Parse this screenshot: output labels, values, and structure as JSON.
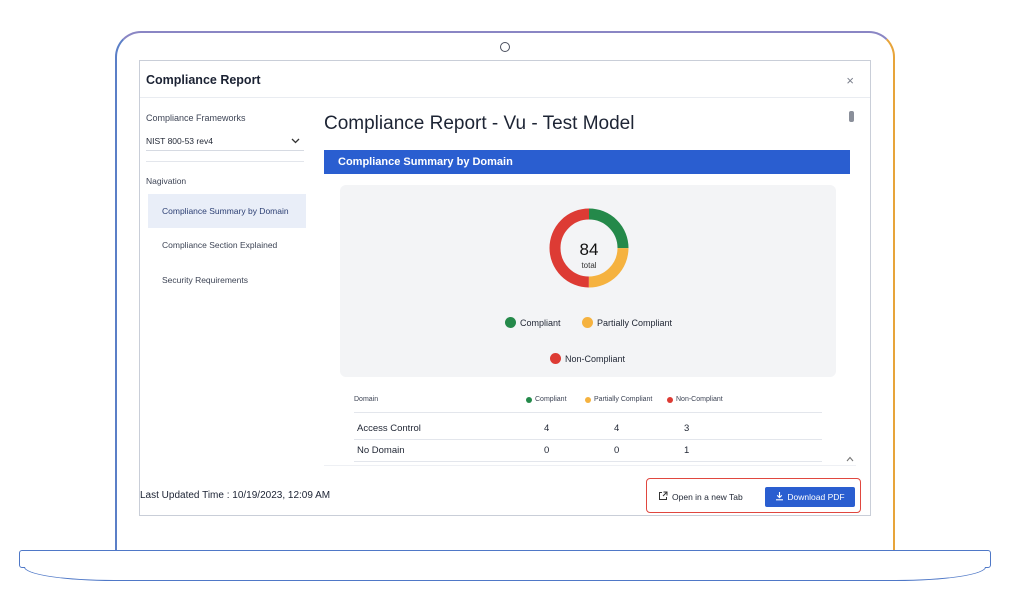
{
  "dialog": {
    "title": "Compliance Report",
    "close_glyph": "×"
  },
  "sidebar": {
    "frameworks_label": "Compliance Frameworks",
    "framework_selected": "NIST 800-53 rev4",
    "navigation_label": "Nagivation",
    "nav_items": [
      {
        "label": "Compliance Summary by Domain",
        "active": true
      },
      {
        "label": "Compliance Section Explained",
        "active": false
      },
      {
        "label": "Security Requirements",
        "active": false
      }
    ]
  },
  "report": {
    "title": "Compliance Report - Vu - Test Model",
    "section_header": "Compliance Summary by Domain"
  },
  "summary": {
    "total_value": "84",
    "total_label": "total",
    "segments": [
      {
        "name": "Compliant",
        "count": 21,
        "color": "#24894a"
      },
      {
        "name": "Partially Compliant",
        "count": 21,
        "color": "#f5b23f"
      },
      {
        "name": "Non-Compliant",
        "count": 42,
        "color": "#dd3b34"
      }
    ]
  },
  "table": {
    "headers": {
      "domain": "Domain",
      "compliant": "Compliant",
      "partial": "Partially Compliant",
      "noncompliant": "Non-Compliant"
    },
    "rows": [
      {
        "domain": "Access Control",
        "compliant": "4",
        "partial": "4",
        "noncompliant": "3"
      },
      {
        "domain": "No Domain",
        "compliant": "0",
        "partial": "0",
        "noncompliant": "1"
      }
    ]
  },
  "footer": {
    "last_updated": "Last Updated Time : 10/19/2023, 12:09 AM",
    "open_tab_label": "Open in a new Tab",
    "download_label": "Download PDF"
  },
  "icons": {
    "open": "external-link-icon",
    "download": "download-icon",
    "dropdown": "chevron-down-icon",
    "close": "close-icon"
  }
}
